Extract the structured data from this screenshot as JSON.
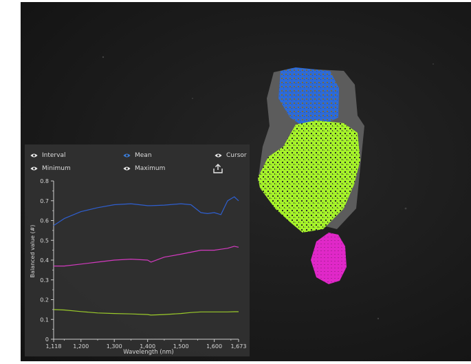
{
  "legend": {
    "interval": "Interval",
    "mean": "Mean",
    "cursor": "Cursor",
    "minimum": "Minimum",
    "maximum": "Maximum"
  },
  "icons": {
    "eye": "eye-icon",
    "export": "export-icon"
  },
  "colors": {
    "panel_bg": "#303030",
    "mean_active": "#3a7bd5",
    "blue_class": "#2e6bd6",
    "green_class": "#a6f32a",
    "magenta_class": "#e028c8"
  },
  "chart_data": {
    "type": "line",
    "xlabel": "Wavelength (nm)",
    "ylabel": "Balanced value (#)",
    "xlim": [
      1118,
      1673
    ],
    "ylim": [
      0,
      0.8
    ],
    "xticks": [
      "1,118",
      "1,200",
      "1,300",
      "1,400",
      "1,500",
      "1,600",
      "1,673"
    ],
    "yticks": [
      "0",
      "0.1",
      "0.2",
      "0.3",
      "0.4",
      "0.5",
      "0.6",
      "0.7",
      "0.8"
    ],
    "x": [
      1118,
      1150,
      1200,
      1250,
      1300,
      1350,
      1400,
      1410,
      1450,
      1500,
      1530,
      1560,
      1580,
      1600,
      1620,
      1640,
      1660,
      1673
    ],
    "series": [
      {
        "color": "#2f5fd0",
        "values": [
          0.575,
          0.61,
          0.645,
          0.665,
          0.68,
          0.685,
          0.675,
          0.675,
          0.678,
          0.685,
          0.68,
          0.64,
          0.635,
          0.64,
          0.63,
          0.7,
          0.72,
          0.7
        ]
      },
      {
        "color": "#d43ac0",
        "values": [
          0.37,
          0.37,
          0.38,
          0.39,
          0.4,
          0.405,
          0.4,
          0.39,
          0.415,
          0.43,
          0.44,
          0.45,
          0.45,
          0.45,
          0.455,
          0.46,
          0.47,
          0.465
        ]
      },
      {
        "color": "#9ccc2a",
        "values": [
          0.15,
          0.148,
          0.14,
          0.133,
          0.13,
          0.128,
          0.125,
          0.122,
          0.125,
          0.13,
          0.135,
          0.138,
          0.138,
          0.138,
          0.138,
          0.138,
          0.139,
          0.139
        ]
      }
    ]
  }
}
